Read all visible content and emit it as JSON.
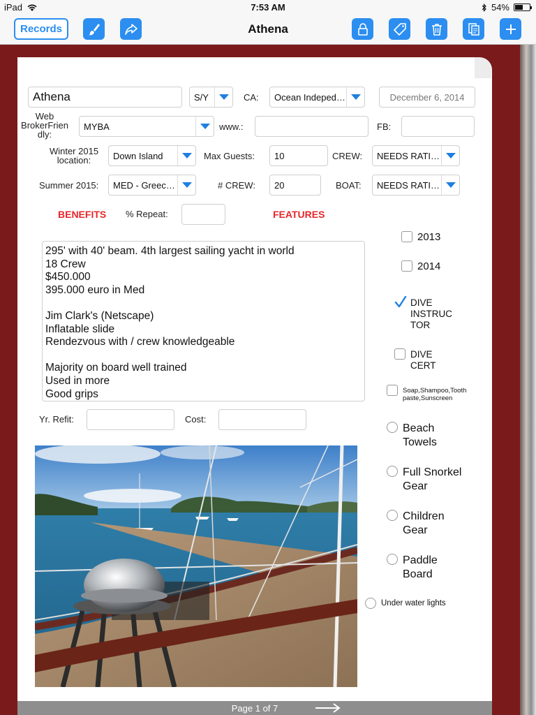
{
  "status": {
    "device": "iPad",
    "time": "7:53 AM",
    "battery": "54%",
    "battery_level": 0.54
  },
  "toolbar": {
    "records_label": "Records",
    "title": "Athena",
    "icons": [
      "paintbrush-icon",
      "share-icon",
      "lock-icon",
      "tag-icon",
      "trash-icon",
      "copy-icon",
      "plus-icon"
    ]
  },
  "form": {
    "name": "Athena",
    "type": "S/Y",
    "ca_label": "CA:",
    "ca": "Ocean Indeped…",
    "date": "December 6, 2014",
    "web_label": "Web BrokerFrien dly:",
    "web": "MYBA",
    "www_label": "www.:",
    "www": "",
    "fb_label": "FB:",
    "fb": "",
    "winter_label": "Winter 2015 location:",
    "winter": "Down Island",
    "max_guests_label": "Max Guests:",
    "max_guests": "10",
    "crew_label": "CREW:",
    "crew": "NEEDS RATI…",
    "summer_label": "Summer 2015:",
    "summer": "MED - Greec…",
    "num_crew_label": "# CREW:",
    "num_crew": "20",
    "boat_label": "BOAT:",
    "boat": "NEEDS RATI…",
    "benefits_label": "BENEFITS",
    "repeat_label": "% Repeat:",
    "repeat": "",
    "features_label": "FEATURES",
    "refit_label": "Yr. Refit:",
    "refit": "",
    "cost_label": "Cost:",
    "cost": ""
  },
  "notes": [
    "295' with 40' beam.      4th largest sailing yacht in world",
    "18 Crew",
    "$450.000",
    "395.000 euro in Med",
    "",
    "Jim Clark's (Netscape)",
    "Inflatable slide",
    "Rendezvous with / crew knowledgeable",
    "",
    "Majority on board well trained",
    "Used in more",
    "Good grips"
  ],
  "features": {
    "y2013": {
      "label": "2013",
      "checked": false
    },
    "y2014": {
      "label": "2014",
      "checked": false
    },
    "dive_instructor": {
      "line1": "DIVE",
      "line2": "INSTRUC",
      "line3": "TOR",
      "checked": true
    },
    "dive_cert": {
      "line1": "DIVE",
      "line2": "CERT",
      "checked": false
    },
    "toiletries": {
      "line1": "Soap,Shampoo,Tooth",
      "line2": "paste,Sunscreen",
      "checked": false
    },
    "beach_towels": {
      "line1": "Beach",
      "line2": "Towels",
      "selected": false
    },
    "snorkel": {
      "line1": "Full Snorkel",
      "line2": "Gear",
      "selected": false
    },
    "children": {
      "line1": "Children",
      "line2": "Gear",
      "selected": false
    },
    "paddle": {
      "line1": "Paddle",
      "line2": "Board",
      "selected": false
    },
    "underwater": {
      "label": "Under water lights",
      "selected": false
    }
  },
  "pager": {
    "label": "Page 1 of 7"
  },
  "colors": {
    "accent": "#2b8ef0",
    "red": "#e5262b",
    "frame": "#7a1a1a"
  }
}
